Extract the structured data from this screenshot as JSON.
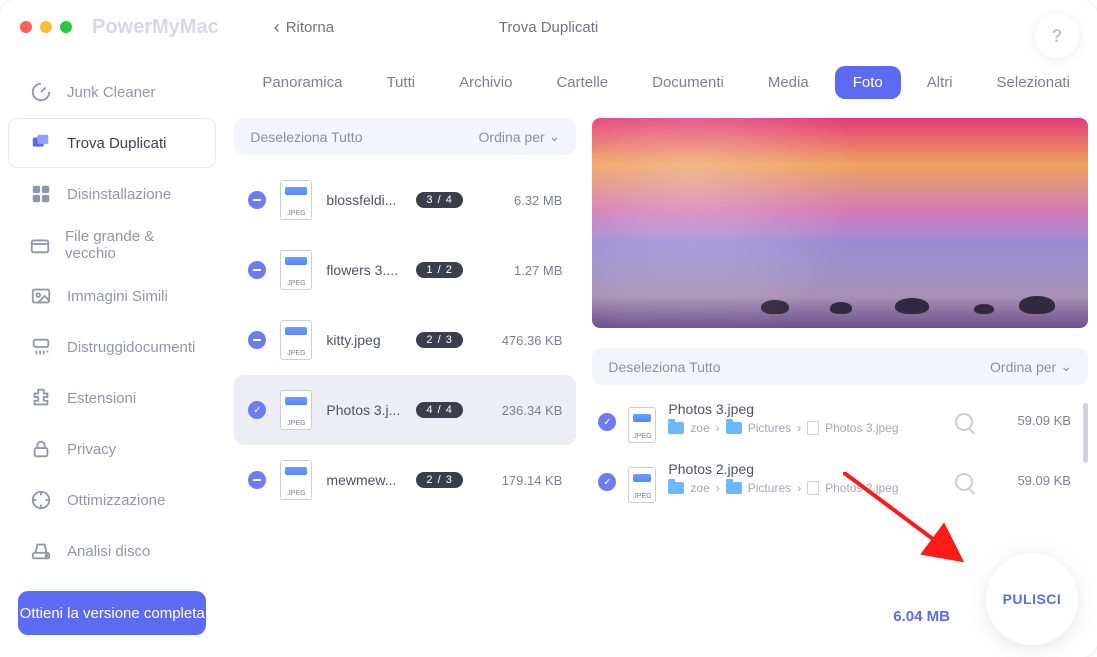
{
  "app": {
    "brand": "PowerMyMac",
    "back_label": "Ritorna",
    "window_title": "Trova Duplicati",
    "help_glyph": "?"
  },
  "sidebar": {
    "items": [
      {
        "label": "Junk Cleaner",
        "active": false,
        "icon": "gauge-icon"
      },
      {
        "label": "Trova Duplicati",
        "active": true,
        "icon": "duplicates-icon"
      },
      {
        "label": "Disinstallazione",
        "active": false,
        "icon": "apps-icon"
      },
      {
        "label": "File grande & vecchio",
        "active": false,
        "icon": "box-icon"
      },
      {
        "label": "Immagini Simili",
        "active": false,
        "icon": "image-icon"
      },
      {
        "label": "Distruggidocumenti",
        "active": false,
        "icon": "shredder-icon"
      },
      {
        "label": "Estensioni",
        "active": false,
        "icon": "extensions-icon"
      },
      {
        "label": "Privacy",
        "active": false,
        "icon": "lock-icon"
      },
      {
        "label": "Ottimizzazione",
        "active": false,
        "icon": "optimize-icon"
      },
      {
        "label": "Analisi disco",
        "active": false,
        "icon": "disk-icon"
      }
    ],
    "full_version_label": "Ottieni la versione completa"
  },
  "tabs": [
    {
      "label": "Panoramica",
      "active": false
    },
    {
      "label": "Tutti",
      "active": false
    },
    {
      "label": "Archivio",
      "active": false
    },
    {
      "label": "Cartelle",
      "active": false
    },
    {
      "label": "Documenti",
      "active": false
    },
    {
      "label": "Media",
      "active": false
    },
    {
      "label": "Foto",
      "active": true
    },
    {
      "label": "Altri",
      "active": false
    },
    {
      "label": "Selezionati",
      "active": false
    }
  ],
  "left": {
    "deselect_label": "Deseleziona Tutto",
    "sort_label": "Ordina per",
    "files": [
      {
        "name": "blossfeldi...",
        "count": "3 / 4",
        "size": "6.32 MB",
        "state": "partial",
        "selected": false
      },
      {
        "name": "flowers 3....",
        "count": "1 / 2",
        "size": "1.27 MB",
        "state": "partial",
        "selected": false
      },
      {
        "name": "kitty.jpeg",
        "count": "2 / 3",
        "size": "476.36 KB",
        "state": "partial",
        "selected": false
      },
      {
        "name": "Photos 3.j...",
        "count": "4 / 4",
        "size": "236.34 KB",
        "state": "full",
        "selected": true
      },
      {
        "name": "mewmew...",
        "count": "2 / 3",
        "size": "179.14 KB",
        "state": "partial",
        "selected": false
      }
    ]
  },
  "right": {
    "deselect_label": "Deseleziona Tutto",
    "sort_label": "Ordina per",
    "items": [
      {
        "name": "Photos 3.jpeg",
        "path_user": "zoe",
        "path_folder": "Pictures",
        "path_file": "Photos 3.jpeg",
        "size": "59.09 KB"
      },
      {
        "name": "Photos 2.jpeg",
        "path_user": "zoe",
        "path_folder": "Pictures",
        "path_file": "Photos 2.jpeg",
        "size": "59.09 KB"
      }
    ]
  },
  "footer": {
    "total_size": "6.04 MB",
    "clean_label": "PULISCI"
  },
  "colors": {
    "accent": "#5d6bf3"
  },
  "icon_labels": {
    "jpeg": "JPEG"
  }
}
